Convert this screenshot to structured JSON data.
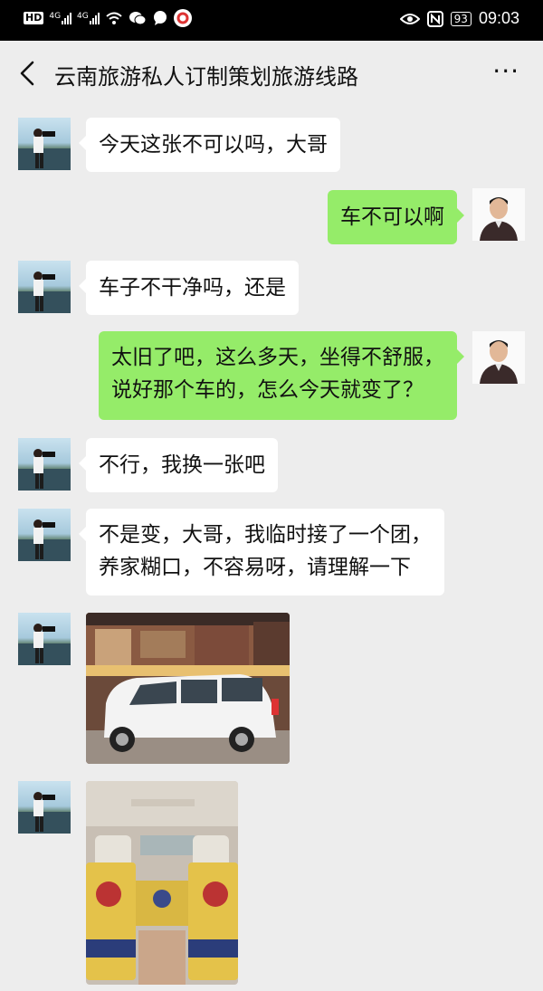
{
  "status_bar": {
    "hd": "HD",
    "net1": "4G",
    "net2": "4G",
    "battery": "93",
    "time": "09:03",
    "icons": [
      "wifi-icon",
      "wechat-icon",
      "chat-icon",
      "app-icon",
      "eye-icon",
      "nfc-icon"
    ]
  },
  "header": {
    "title": "云南旅游私人订制策划旅游线路",
    "back_icon": "chevron-left-icon",
    "more_label": "···"
  },
  "messages": [
    {
      "side": "left",
      "type": "text",
      "text": "今天这张不可以吗，大哥"
    },
    {
      "side": "right",
      "type": "text",
      "text": "车不可以啊"
    },
    {
      "side": "left",
      "type": "text",
      "text": "车子不干净吗，还是"
    },
    {
      "side": "right",
      "type": "text",
      "lines": [
        "太旧了吧，这么多天，坐得不舒服，",
        "说好那个车的，怎么今天就变了？"
      ]
    },
    {
      "side": "left",
      "type": "text",
      "text": "不行，我换一张吧"
    },
    {
      "side": "left",
      "type": "text",
      "lines": [
        "不是变，大哥，我临时接了一个团，",
        "养家糊口，不容易呀，请理解一下"
      ]
    },
    {
      "side": "left",
      "type": "image",
      "description": "white van parked in front of building"
    },
    {
      "side": "left",
      "type": "image",
      "description": "van interior with patterned seat covers"
    }
  ],
  "colors": {
    "background": "#ededed",
    "bubble_self": "#95ec69",
    "bubble_other": "#ffffff"
  }
}
